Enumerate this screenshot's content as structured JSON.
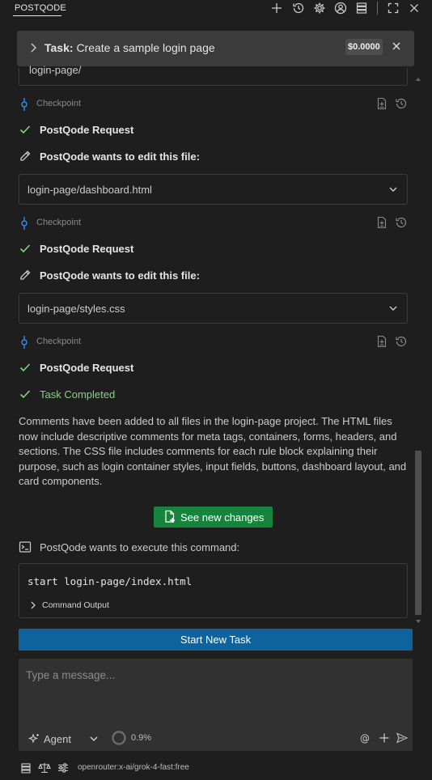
{
  "header": {
    "title": "POSTQODE",
    "icons": [
      "plus-icon",
      "history-icon",
      "gear-icon",
      "account-icon",
      "server-icon",
      "fullscreen-icon",
      "close-icon"
    ]
  },
  "task": {
    "label": "Task:",
    "text": "Create a sample login page",
    "cost": "$0.0000"
  },
  "partial_file": "login-page/",
  "checkpoints": [
    {
      "label": "Checkpoint"
    },
    {
      "label": "Checkpoint"
    },
    {
      "label": "Checkpoint"
    }
  ],
  "messages": [
    {
      "type": "request",
      "text": "PostQode Request"
    },
    {
      "type": "edit",
      "text": "PostQode wants to edit this file:",
      "file": "login-page/dashboard.html"
    },
    {
      "type": "request",
      "text": "PostQode Request"
    },
    {
      "type": "edit",
      "text": "PostQode wants to edit this file:",
      "file": "login-page/styles.css"
    },
    {
      "type": "request",
      "text": "PostQode Request"
    },
    {
      "type": "completed",
      "text": "Task Completed"
    }
  ],
  "completion_text": "Comments have been added to all files in the login-page project. The HTML files now include descriptive comments for meta tags, containers, forms, headers, and sections. The CSS file includes comments for each rule block explaining their purpose, such as login container styles, input fields, buttons, dashboard layout, and card components.",
  "see_changes_label": "See new changes",
  "command": {
    "heading": "PostQode wants to execute this command:",
    "code": "start login-page/index.html",
    "output_label": "Command Output"
  },
  "start_new_task_label": "Start New Task",
  "input": {
    "placeholder": "Type a message...",
    "mode": "Agent",
    "context_usage": "0.9%"
  },
  "footer": {
    "model": "openrouter:x-ai/grok-4-fast:free"
  },
  "colors": {
    "background": "#1e1e1e",
    "accent_blue": "#0e639c",
    "accent_green": "#16843d",
    "success": "#89d185",
    "checkpoint_icon": "#3794ff"
  }
}
